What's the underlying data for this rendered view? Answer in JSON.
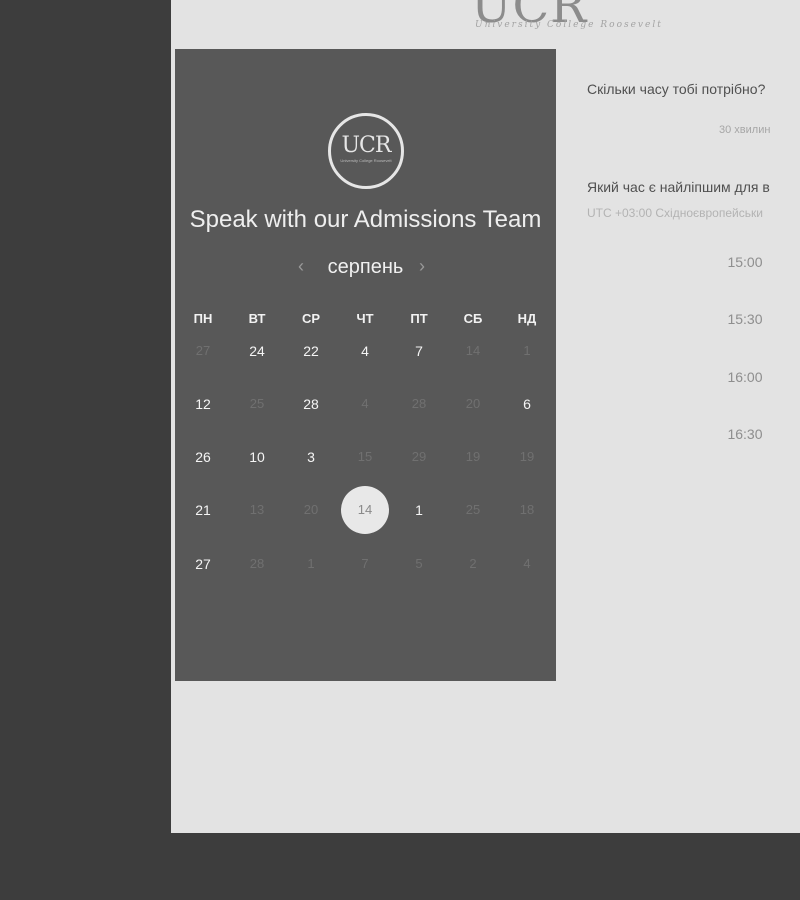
{
  "brand": {
    "mark": "UCR",
    "tagline": "University College Roosevelt"
  },
  "panel": {
    "logo_text": "UCR",
    "logo_sub": "University College Roosevelt",
    "title": "Speak with our Admissions Team"
  },
  "calendar": {
    "month": "серпень",
    "prev_icon": "chevron-left-icon",
    "next_icon": "chevron-right-icon",
    "weekdays": [
      "ПН",
      "ВТ",
      "СР",
      "ЧТ",
      "ПТ",
      "СБ",
      "НД"
    ],
    "weeks": [
      [
        {
          "d": "27",
          "available": false
        },
        {
          "d": "24",
          "available": true
        },
        {
          "d": "22",
          "available": true
        },
        {
          "d": "4",
          "available": true
        },
        {
          "d": "7",
          "available": true
        },
        {
          "d": "14",
          "available": false
        },
        {
          "d": "1",
          "available": false
        }
      ],
      [
        {
          "d": "12",
          "available": true
        },
        {
          "d": "25",
          "available": false
        },
        {
          "d": "28",
          "available": true
        },
        {
          "d": "4",
          "available": false
        },
        {
          "d": "28",
          "available": false
        },
        {
          "d": "20",
          "available": false
        },
        {
          "d": "6",
          "available": true
        }
      ],
      [
        {
          "d": "26",
          "available": true
        },
        {
          "d": "10",
          "available": true
        },
        {
          "d": "3",
          "available": true
        },
        {
          "d": "15",
          "available": false
        },
        {
          "d": "29",
          "available": false
        },
        {
          "d": "19",
          "available": false
        },
        {
          "d": "19",
          "available": false
        }
      ],
      [
        {
          "d": "21",
          "available": true
        },
        {
          "d": "13",
          "available": false
        },
        {
          "d": "20",
          "available": false
        },
        {
          "d": "14",
          "available": true,
          "selected": true
        },
        {
          "d": "1",
          "available": true
        },
        {
          "d": "25",
          "available": false
        },
        {
          "d": "18",
          "available": false
        }
      ],
      [
        {
          "d": "27",
          "available": true
        },
        {
          "d": "28",
          "available": false
        },
        {
          "d": "1",
          "available": false
        },
        {
          "d": "7",
          "available": false
        },
        {
          "d": "5",
          "available": false
        },
        {
          "d": "2",
          "available": false
        },
        {
          "d": "4",
          "available": false
        }
      ]
    ]
  },
  "booking": {
    "duration_question": "Скільки часу тобі потрібно?",
    "duration_value": "30 хвилин",
    "time_question": "Який час є найліпшим для в",
    "timezone": "UTC +03:00 Східноєвропейськи",
    "slots": [
      "15:00",
      "15:30",
      "16:00",
      "16:30"
    ]
  },
  "colors": {
    "panel_bg": "#585858",
    "page_bg": "#e3e3e3",
    "backdrop": "#3d3d3d",
    "selected_day_bg": "#e8e8e8"
  }
}
